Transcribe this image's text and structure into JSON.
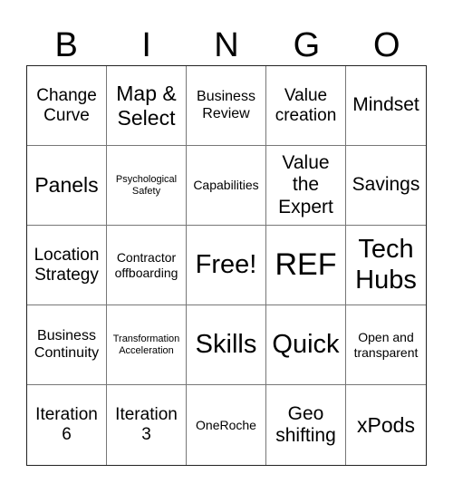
{
  "header": {
    "letters": [
      "B",
      "I",
      "N",
      "G",
      "O"
    ]
  },
  "cells": [
    {
      "text": "Change Curve",
      "size": "s-lg"
    },
    {
      "text": "Map & Select",
      "size": "s-xl"
    },
    {
      "text": "Business Review",
      "size": "s-md"
    },
    {
      "text": "Value creation",
      "size": "s-lg"
    },
    {
      "text": "Mindset",
      "size": "s-lg2"
    },
    {
      "text": "Panels",
      "size": "s-xl"
    },
    {
      "text": "Psychological Safety",
      "size": "s-xs"
    },
    {
      "text": "Capabilities",
      "size": "s-sm"
    },
    {
      "text": "Value the Expert",
      "size": "s-lg2"
    },
    {
      "text": "Savings",
      "size": "s-lg2"
    },
    {
      "text": "Location Strategy",
      "size": "s-lg"
    },
    {
      "text": "Contractor offboarding",
      "size": "s-sm"
    },
    {
      "text": "Free!",
      "size": "s-xxl"
    },
    {
      "text": "REF",
      "size": "s-huge"
    },
    {
      "text": "Tech Hubs",
      "size": "s-xxl"
    },
    {
      "text": "Business Continuity",
      "size": "s-md"
    },
    {
      "text": "Transformation Acceleration",
      "size": "s-xs"
    },
    {
      "text": "Skills",
      "size": "s-xxl"
    },
    {
      "text": "Quick",
      "size": "s-xxl"
    },
    {
      "text": "Open and transparent",
      "size": "s-sm"
    },
    {
      "text": "Iteration 6",
      "size": "s-lg"
    },
    {
      "text": "Iteration 3",
      "size": "s-lg"
    },
    {
      "text": "OneRoche",
      "size": "s-sm"
    },
    {
      "text": "Geo shifting",
      "size": "s-lg2"
    },
    {
      "text": "xPods",
      "size": "s-xl"
    }
  ]
}
